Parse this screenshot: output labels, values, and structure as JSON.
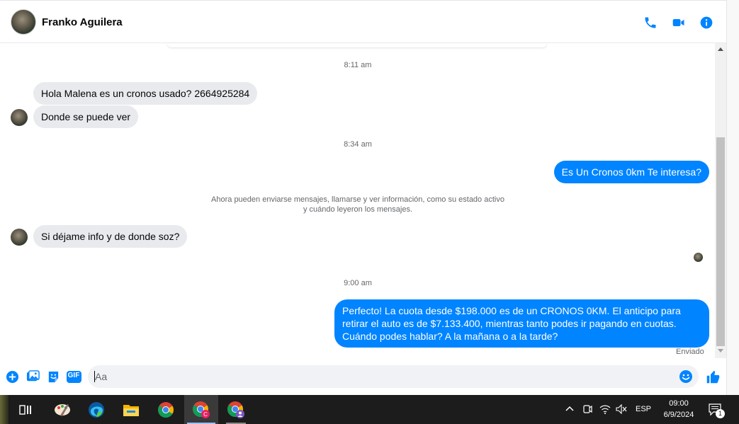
{
  "header": {
    "contact_name": "Franko Aguilera",
    "icons": [
      "phone-icon",
      "video-camera-icon",
      "info-icon"
    ]
  },
  "colors": {
    "accent": "#0084ff",
    "incoming_bubble": "#e9eaed",
    "muted_text": "#65676b",
    "taskbar": "#1c1c1c"
  },
  "conversation": {
    "time_1": "8:11 am",
    "msg_1": "Hola Malena es un cronos usado? 2664925284",
    "msg_2": "Donde se puede ver",
    "time_2": "8:34 am",
    "msg_3": "Es Un Cronos 0km Te interesa?",
    "info_line_1": "Ahora pueden enviarse mensajes, llamarse y ver información, como su estado activo",
    "info_line_2": "y cuándo leyeron los mensajes.",
    "msg_4": "Si déjame info y de donde soz?",
    "time_3": "9:00 am",
    "msg_5": "Perfecto! La cuota desde $198.000 es de un CRONOS 0KM. El anticipo para retirar el auto es de $7.133.400, mientras tanto podes ir pagando en cuotas. Cuándo podes hablar? A la mañana o a la tarde?",
    "status": "Enviado"
  },
  "composer": {
    "placeholder": "Aa",
    "icons": [
      "plus-circle-icon",
      "image-icon",
      "sticker-icon",
      "gif-icon",
      "emoji-icon",
      "thumbs-up-icon"
    ],
    "gif_label": "GIF"
  },
  "taskbar": {
    "apps": [
      "paint-icon",
      "edge-icon",
      "file-explorer-icon",
      "chrome-icon",
      "chrome-profile-c-icon",
      "chrome-profile-2-icon"
    ],
    "language": "ESP",
    "time": "09:00",
    "date": "6/9/2024",
    "notification_count": "1"
  }
}
